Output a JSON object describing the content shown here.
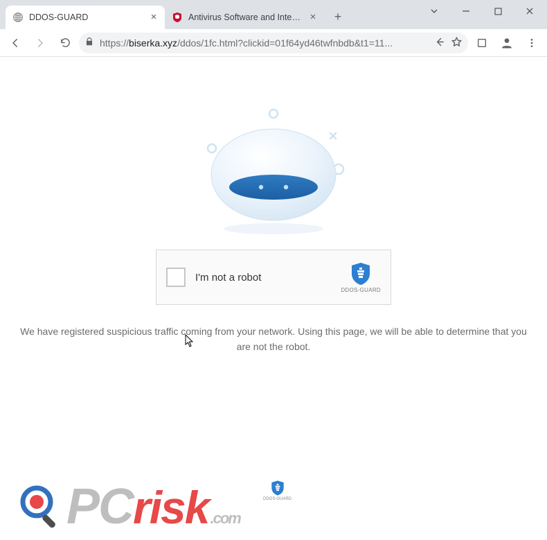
{
  "window": {
    "tabs": [
      {
        "title": "DDOS-GUARD",
        "favicon": "globe",
        "active": true
      },
      {
        "title": "Antivirus Software and Internet S",
        "favicon": "mcafee",
        "active": false
      }
    ],
    "url_scheme": "https://",
    "url_host": "biserka.xyz",
    "url_path": "/ddos/1fc.html?clickid=01f64yd46twfnbdb&t1=11..."
  },
  "page": {
    "captcha_label": "I'm not a robot",
    "captcha_brand": "DDOS-GUARD",
    "info_text": "We have registered suspicious traffic coming from your network. Using this page, we will be able to determine that you are not the robot."
  },
  "watermark": {
    "pc_prefix": "PC",
    "red_word": "risk",
    "domain": ".com",
    "mini_brand": "DDOS-GUARD"
  }
}
